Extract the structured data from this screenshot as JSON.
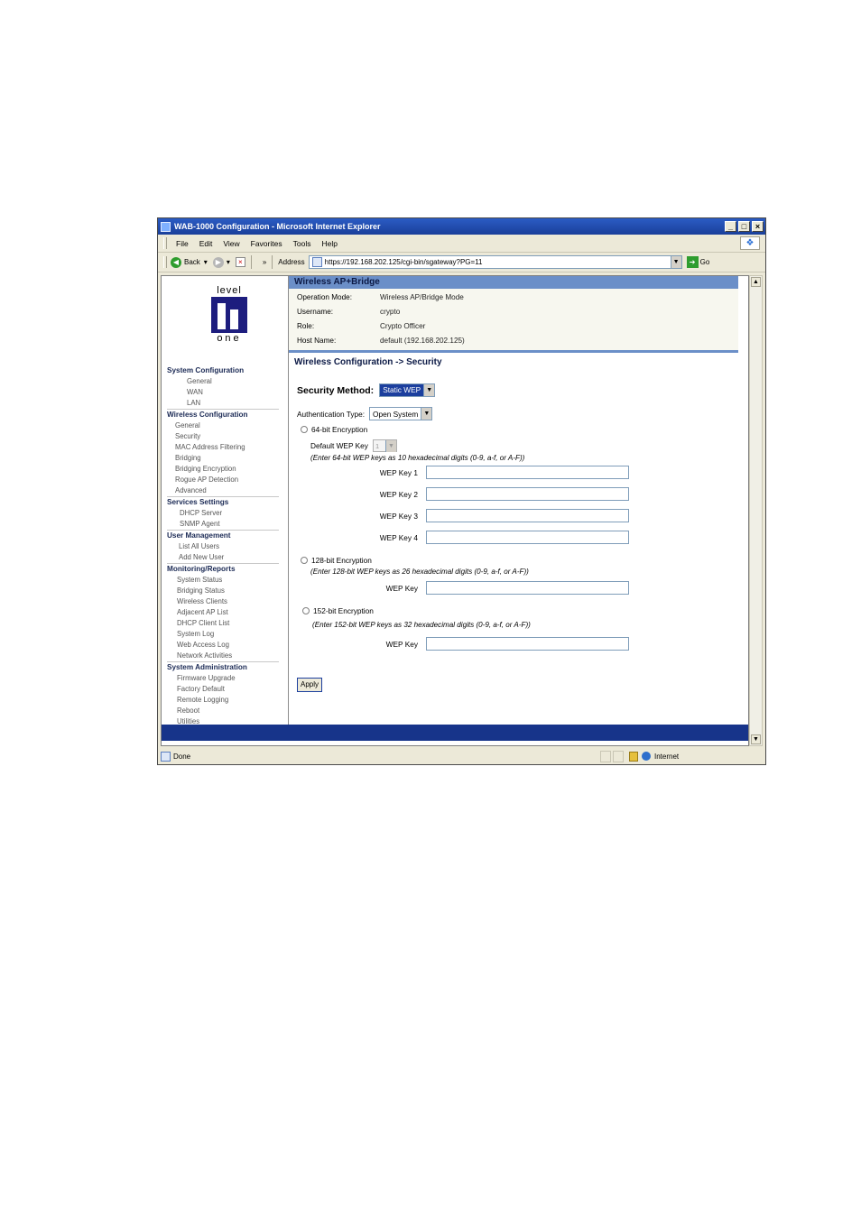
{
  "window": {
    "title": "WAB-1000 Configuration - Microsoft Internet Explorer",
    "controls": [
      "_",
      "□",
      "×"
    ]
  },
  "menu": [
    "File",
    "Edit",
    "View",
    "Favorites",
    "Tools",
    "Help"
  ],
  "toolbar": {
    "back_label": "Back",
    "back_arrow": "▾",
    "fwd_arrow": "▾",
    "overflow": "»",
    "address_label": "Address",
    "address_value": "https://192.168.202.125/cgi-bin/sgateway?PG=11",
    "go_label": "Go"
  },
  "logo": {
    "top": "level",
    "bottom": "one"
  },
  "sidebar": {
    "sections": [
      {
        "title": "System Configuration",
        "items": [
          "General",
          "WAN",
          "LAN"
        ]
      },
      {
        "title": "Wireless Configuration",
        "items": [
          "General",
          "Security",
          "MAC Address Filtering",
          "Bridging",
          "Bridging Encryption",
          "Rogue AP Detection",
          "Advanced"
        ]
      },
      {
        "title": "Services Settings",
        "items": [
          "DHCP Server",
          "SNMP Agent"
        ]
      },
      {
        "title": "User Management",
        "items": [
          "List All Users",
          "Add New User"
        ]
      },
      {
        "title": "Monitoring/Reports",
        "items": [
          "System Status",
          "Bridging Status",
          "Wireless Clients",
          "Adjacent AP List",
          "DHCP Client List",
          "System Log",
          "Web Access Log",
          "Network Activities"
        ]
      },
      {
        "title": "System Administration",
        "items": [
          "Firmware Upgrade",
          "Factory Default",
          "Remote Logging",
          "Reboot",
          "Utilities"
        ]
      }
    ]
  },
  "header": {
    "title": "Wireless AP+Bridge",
    "info": [
      {
        "label": "Operation Mode:",
        "value": "Wireless AP/Bridge Mode"
      },
      {
        "label": "Username:",
        "value": "crypto"
      },
      {
        "label": "Role:",
        "value": "Crypto Officer"
      },
      {
        "label": "Host Name:",
        "value": "default (192.168.202.125)"
      }
    ]
  },
  "page": {
    "section_title": "Wireless Configuration -> Security",
    "security_method_label": "Security Method:",
    "security_method_value": "Static WEP",
    "auth_type_label": "Authentication Type:",
    "auth_type_value": "Open System",
    "enc64_label": "64-bit Encryption",
    "default_key_label": "Default WEP Key",
    "default_key_value": "1",
    "enc64_note": "(Enter 64-bit WEP keys as 10 hexadecimal digits (0-9, a-f, or A-F))",
    "wep_keys": [
      "WEP Key 1",
      "WEP Key 2",
      "WEP Key 3",
      "WEP Key 4"
    ],
    "enc128_label": "128-bit Encryption",
    "enc128_note": "(Enter 128-bit WEP keys as 26 hexadecimal digits (0-9, a-f, or A-F))",
    "enc128_key_label": "WEP Key",
    "enc152_label": "152-bit Encryption",
    "enc152_note": "(Enter 152-bit WEP keys as 32 hexadecimal digits (0-9, a-f, or A-F))",
    "enc152_key_label": "WEP Key",
    "apply_label": "Apply"
  },
  "status": {
    "text": "Done",
    "zone": "Internet"
  }
}
